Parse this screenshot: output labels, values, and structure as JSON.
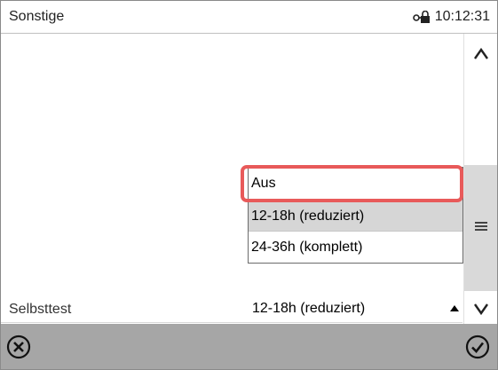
{
  "header": {
    "title": "Sonstige",
    "time": "10:12:31",
    "status_icon": "lock-key-icon"
  },
  "setting": {
    "label": "Selbsttest",
    "selected_value": "12-18h (reduziert)"
  },
  "dropdown": {
    "options": [
      {
        "label": "Aus"
      },
      {
        "label": "12-18h (reduziert)"
      },
      {
        "label": "24-36h (komplett)"
      }
    ],
    "focused_option": "Aus",
    "highlighted_option": "12-18h (reduziert)"
  },
  "scrollbar": {
    "up_icon": "chevron-up-icon",
    "down_icon": "chevron-down-icon",
    "handle_icon": "menu-lines-icon"
  },
  "footer": {
    "cancel_icon": "cancel-circle-icon",
    "confirm_icon": "confirm-check-icon"
  },
  "colors": {
    "focus_ring": "#e85a5a",
    "footer_bg": "#a6a6a6",
    "highlight_bg": "#d6d6d6",
    "scroll_thumb": "#d9d9d9"
  }
}
